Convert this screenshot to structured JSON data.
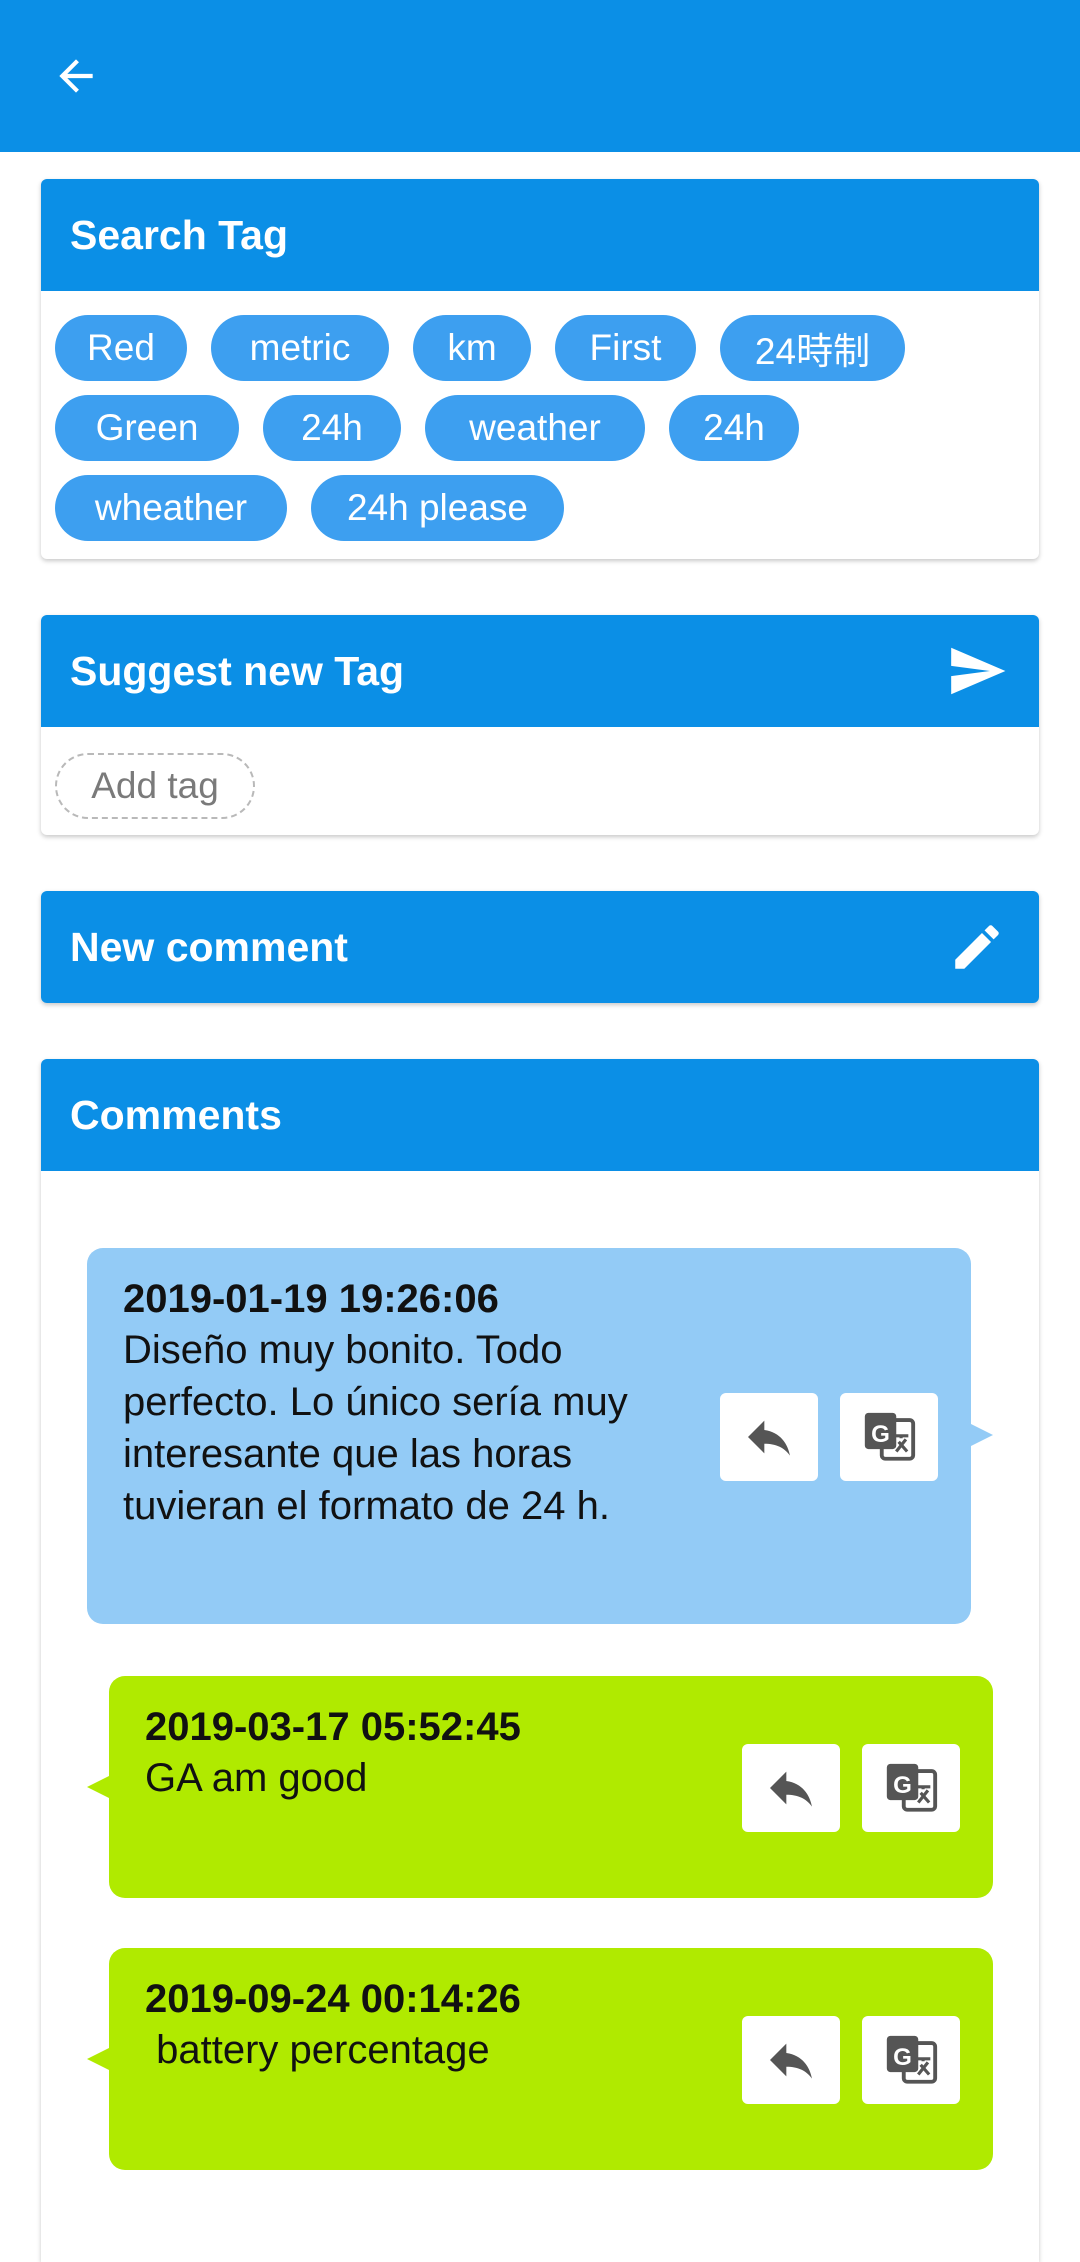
{
  "colors": {
    "primary": "#0b8fe6",
    "tag": "#3d9ff0",
    "bubble_own": "#93cbf6",
    "bubble_reply": "#b0ea00"
  },
  "search_tag": {
    "title": "Search Tag",
    "tags": [
      "Red",
      "metric",
      "km",
      "First",
      "24時制",
      "Green",
      "24h",
      "weather",
      "24h",
      "wheather",
      "24h please"
    ]
  },
  "suggest_tag": {
    "title": "Suggest new Tag",
    "send_icon": "send-icon",
    "add_tag_placeholder": "Add tag"
  },
  "new_comment": {
    "title": "New comment",
    "edit_icon": "pencil-icon"
  },
  "comments": {
    "title": "Comments",
    "items": [
      {
        "date": "2019-01-19 19:26:06",
        "text": "Diseño muy bonito. Todo perfecto. Lo único sería muy interesante que las horas tuvieran el formato de 24 h."
      },
      {
        "date": "2019-03-17 05:52:45",
        "text": "GA am good"
      },
      {
        "date": "2019-09-24 00:14:26",
        "text": " battery percentage"
      }
    ]
  }
}
